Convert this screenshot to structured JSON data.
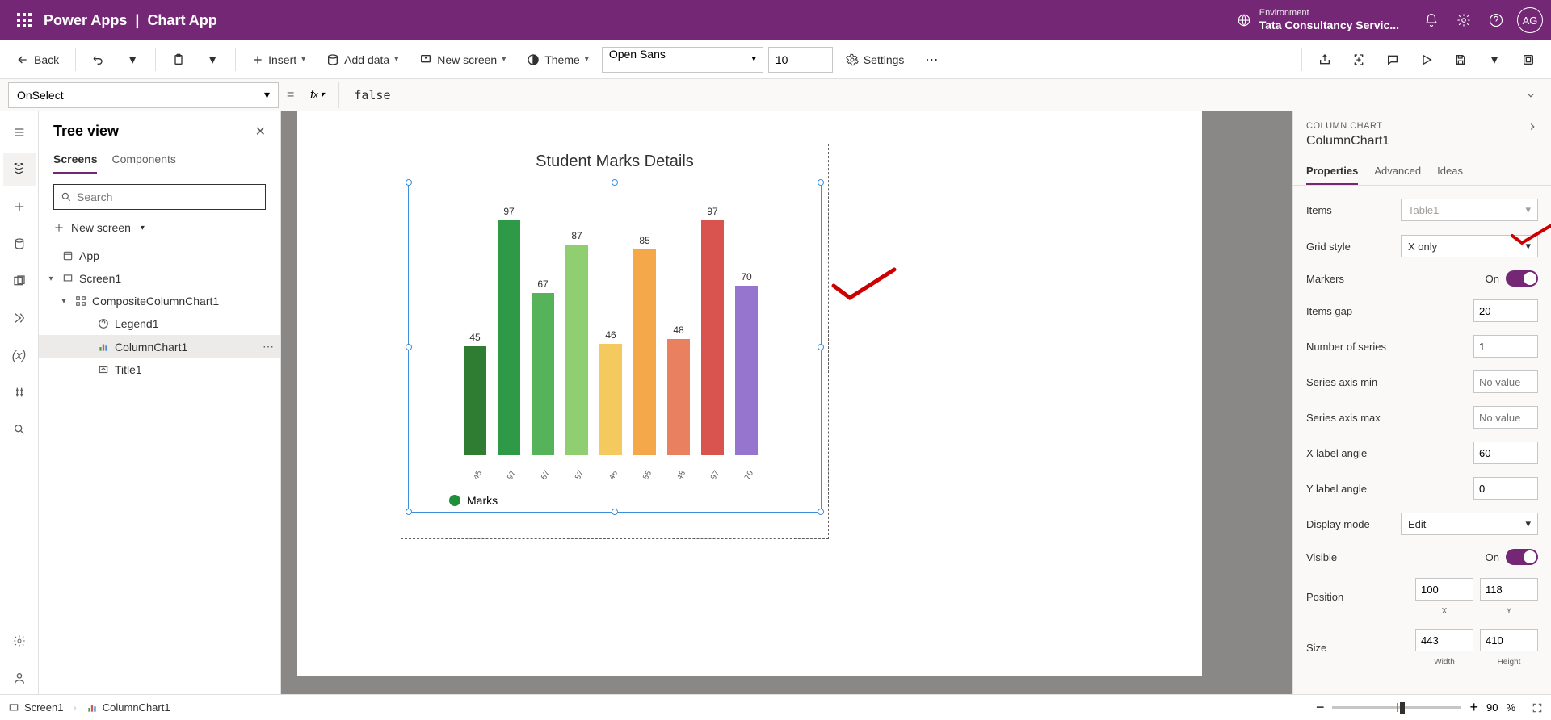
{
  "header": {
    "product": "Power Apps",
    "separator": "|",
    "app_name": "Chart App",
    "env_label": "Environment",
    "env_name": "Tata Consultancy Servic...",
    "avatar_initials": "AG"
  },
  "ribbon": {
    "back": "Back",
    "insert": "Insert",
    "add_data": "Add data",
    "new_screen": "New screen",
    "theme": "Theme",
    "font_family": "Open Sans",
    "font_size": "10",
    "settings": "Settings"
  },
  "formula": {
    "property": "OnSelect",
    "equals": "=",
    "fx": "fx",
    "value": "false"
  },
  "tree": {
    "title": "Tree view",
    "tab_screens": "Screens",
    "tab_components": "Components",
    "search_placeholder": "Search",
    "new_screen": "New screen",
    "items": {
      "app": "App",
      "screen1": "Screen1",
      "composite": "CompositeColumnChart1",
      "legend": "Legend1",
      "columnchart": "ColumnChart1",
      "title1": "Title1"
    }
  },
  "chart": {
    "title": "Student Marks Details",
    "legend": "Marks"
  },
  "chart_data": {
    "type": "bar",
    "title": "Student Marks Details",
    "categories": [
      "45",
      "97",
      "67",
      "87",
      "46",
      "85",
      "48",
      "97",
      "70"
    ],
    "values": [
      45,
      97,
      67,
      87,
      46,
      85,
      48,
      97,
      70
    ],
    "colors": [
      "#2e7d32",
      "#2e9a47",
      "#56b35a",
      "#8fcf72",
      "#f4c95d",
      "#f4a84a",
      "#e98160",
      "#d9534f",
      "#9575cd"
    ],
    "xlabel": "",
    "ylabel": "",
    "ylim": [
      0,
      100
    ],
    "legend": [
      "Marks"
    ],
    "x_label_angle": 60
  },
  "props": {
    "type_label": "COLUMN CHART",
    "name": "ColumnChart1",
    "tab_properties": "Properties",
    "tab_advanced": "Advanced",
    "tab_ideas": "Ideas",
    "items_label": "Items",
    "items_value": "Table1",
    "grid_style_label": "Grid style",
    "grid_style_value": "X only",
    "markers_label": "Markers",
    "markers_value": "On",
    "items_gap_label": "Items gap",
    "items_gap_value": "20",
    "num_series_label": "Number of series",
    "num_series_value": "1",
    "axis_min_label": "Series axis min",
    "axis_min_placeholder": "No value",
    "axis_max_label": "Series axis max",
    "axis_max_placeholder": "No value",
    "x_angle_label": "X label angle",
    "x_angle_value": "60",
    "y_angle_label": "Y label angle",
    "y_angle_value": "0",
    "display_mode_label": "Display mode",
    "display_mode_value": "Edit",
    "visible_label": "Visible",
    "visible_value": "On",
    "position_label": "Position",
    "position_x": "100",
    "position_y": "118",
    "pos_x_sub": "X",
    "pos_y_sub": "Y",
    "size_label": "Size",
    "size_w": "443",
    "size_h": "410",
    "size_w_sub": "Width",
    "size_h_sub": "Height"
  },
  "bottom": {
    "screen": "Screen1",
    "selected": "ColumnChart1",
    "zoom": "90",
    "percent": "%"
  }
}
